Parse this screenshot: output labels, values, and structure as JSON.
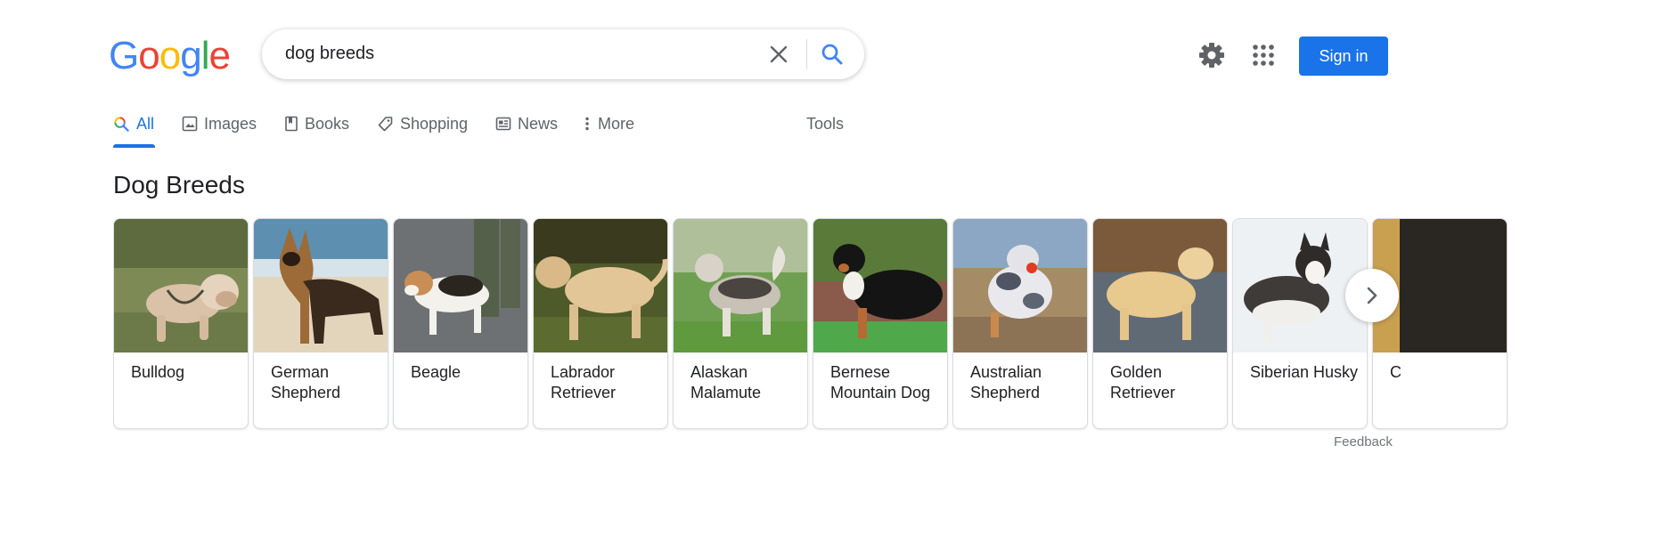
{
  "logo": {
    "letters": [
      "G",
      "o",
      "o",
      "g",
      "l",
      "e"
    ],
    "colors": [
      "#4285f4",
      "#ea4335",
      "#fbbc05",
      "#4285f4",
      "#34a853",
      "#ea4335"
    ]
  },
  "search": {
    "query": "dog breeds"
  },
  "header": {
    "sign_in_label": "Sign in"
  },
  "tabs": [
    {
      "label": "All",
      "icon": "search-multicolor-icon",
      "active": true
    },
    {
      "label": "Images",
      "icon": "image-icon"
    },
    {
      "label": "Books",
      "icon": "book-icon"
    },
    {
      "label": "Shopping",
      "icon": "tag-icon"
    },
    {
      "label": "News",
      "icon": "newspaper-icon"
    },
    {
      "label": "More",
      "icon": "vertical-dots-icon"
    },
    {
      "label": "Tools",
      "icon": ""
    }
  ],
  "section": {
    "title": "Dog Breeds"
  },
  "breeds": [
    {
      "name": "Bulldog"
    },
    {
      "name": "German Shepherd"
    },
    {
      "name": "Beagle"
    },
    {
      "name": "Labrador Retriever"
    },
    {
      "name": "Alaskan Malamute"
    },
    {
      "name": "Bernese Mountain Dog"
    },
    {
      "name": "Australian Shepherd"
    },
    {
      "name": "Golden Retriever"
    },
    {
      "name": "Siberian Husky"
    },
    {
      "name": "C"
    }
  ],
  "footer": {
    "feedback_label": "Feedback"
  },
  "colors": {
    "accent": "#1a73e8",
    "text": "#202124",
    "muted": "#5f6368"
  }
}
